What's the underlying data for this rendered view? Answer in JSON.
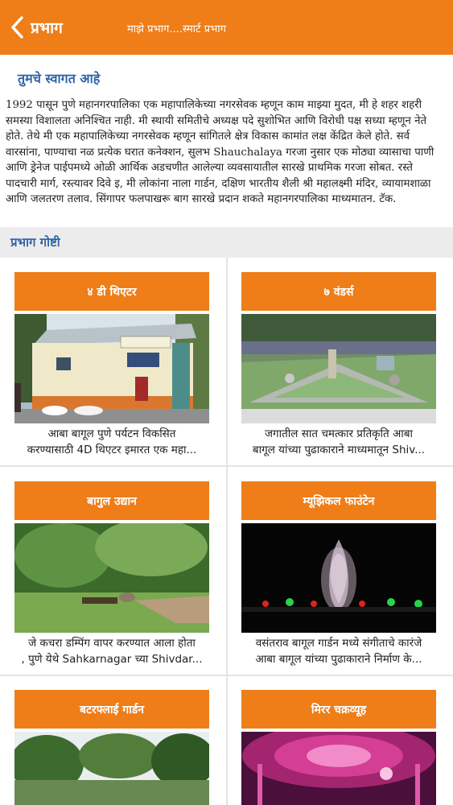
{
  "header": {
    "title": "प्रभाग",
    "subtitle": "माझे प्रभाग....स्मार्ट प्रभाग"
  },
  "welcome": "तुमचे स्वागत आहे",
  "intro": "1992 पासून पुणे महानगरपालिका एक महापालिकेच्या नगरसेवक म्हणून काम माझ्या मुदत, मी हे शहर शहरी समस्या विशालता अनिश्चित नाही. मी स्थायी समितीचे अध्यक्ष पदे सुशोभित आणि विरोधी पक्ष सध्या म्हणून नेते होते. तेथे मी एक महापालिकेच्या नगरसेवक म्हणून सांगितले क्षेत्र विकास कामांत लक्ष केंद्रित केले होते. सर्व वारसांना, पाण्याचा नळ प्रत्येक घरात कनेक्शन, सुलभ Shauchalaya गरजा नुसार एक मोठ्या व्यासाचा पाणी आणि ड्रेनेज पाईपमध्ये ओळी आर्थिक अडचणीत आलेल्या व्यवसायातील सारखे प्राथमिक गरजा सोबत. रस्ते पादचारी मार्ग, रस्त्यावर दिवे इ, मी लोकांना नाला गार्डन, दक्षिण भारतीय शैली श्री महालक्ष्मी मंदिर, व्यायामशाळा आणि जलतरण तलाव. सिंगापर फलपाखरू बाग सारखे प्रदान शकते महानगरपालिका माध्यमातन. टॅक.",
  "section_title": "प्रभाग गोष्टी",
  "cards": [
    {
      "title": "४ डी थिएटर",
      "line1": "आबा बागूल पुणे पर्यटन विकसित",
      "line2": "करण्यासाठी 4D थिएटर इमारत एक महा...",
      "image": "theater-building-photo"
    },
    {
      "title": "७ वंडर्स",
      "line1": "जगातील सात चमत्कार प्रतिकृति आबा",
      "line2": "बागूल यांच्या पुढाकाराने माध्यमातून Shiv...",
      "image": "seven-wonders-park-photo"
    },
    {
      "title": "बागुल उद्यान",
      "line1": "जे कचरा डम्पिंग वापर करण्यात आला होता",
      "line2": ", पुणे येथे Sahkarnagar च्या Shivdar...",
      "image": "garden-photo"
    },
    {
      "title": "म्यूझिकल फाउंटेन",
      "line1": "वसंतराव बागूल गार्डन मध्ये संगीताचे कारंजे",
      "line2": "आबा बागूल यांच्या पुढाकाराने निर्माण के...",
      "image": "musical-fountain-photo"
    },
    {
      "title": "बटरफ्लाई  गार्डन",
      "line1": "",
      "line2": "",
      "image": "butterfly-garden-photo"
    },
    {
      "title": "मिरर चक्रव्यूह",
      "line1": "",
      "line2": "",
      "image": "mirror-maze-photo"
    }
  ],
  "colors": {
    "accent": "#ef7d18",
    "link_blue": "#2f63a6",
    "section_bg": "#ececec"
  }
}
